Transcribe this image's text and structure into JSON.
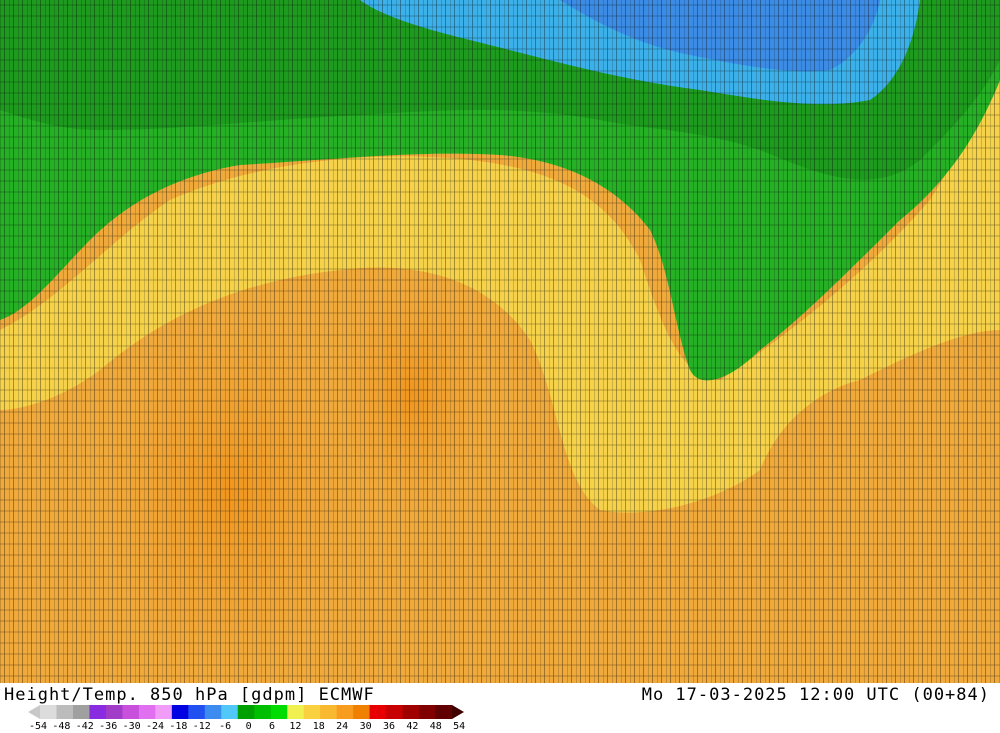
{
  "title_left": "Height/Temp. 850 hPa [gdpm] ECMWF",
  "title_right": "Mo 17-03-2025 12:00 UTC (00+84)",
  "colorbar": {
    "colors": [
      "#dcdcdc",
      "#bcbcbc",
      "#a0a0a0",
      "#8a2be2",
      "#a03cc8",
      "#c850dc",
      "#e070f0",
      "#f09cf8",
      "#0000e0",
      "#2050f0",
      "#3c8cf0",
      "#50c8f8",
      "#00a000",
      "#00be00",
      "#00dc00",
      "#f0f050",
      "#f8d040",
      "#f8b830",
      "#f89c20",
      "#f08000",
      "#e80000",
      "#c80000",
      "#a00000",
      "#800000",
      "#600000"
    ],
    "ticks": [
      "-54",
      "-48",
      "-42",
      "-36",
      "-30",
      "-24",
      "-18",
      "-12",
      "-6",
      "0",
      "6",
      "12",
      "18",
      "24",
      "30",
      "36",
      "42",
      "48",
      "54"
    ]
  }
}
